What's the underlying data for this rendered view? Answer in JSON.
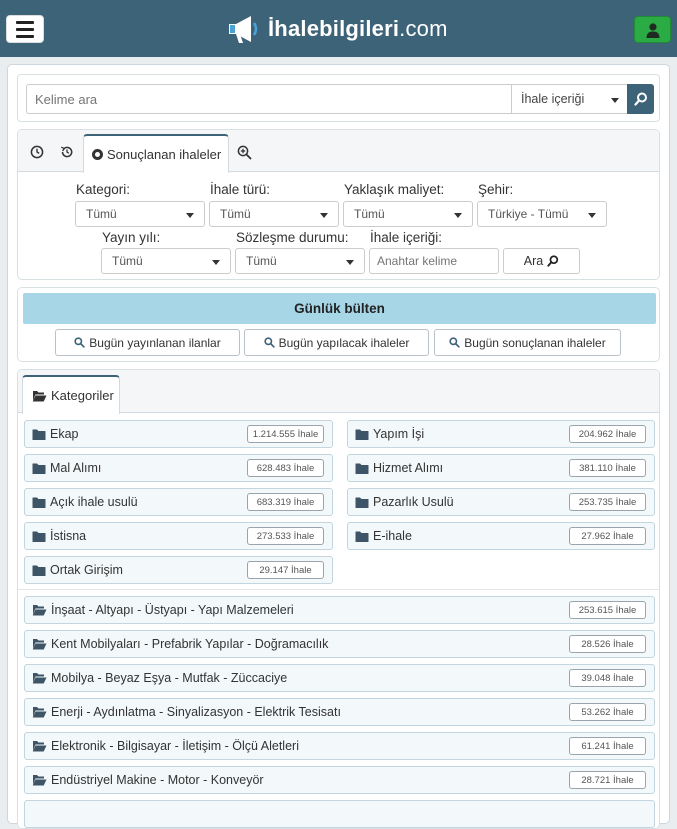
{
  "header": {
    "logo_bold": "İhalebilgileri",
    "logo_light": ".com",
    "colors": {
      "bar": "#3d6379",
      "user_button": "#2bab43"
    },
    "menu_icon": "hamburger-icon",
    "user_icon": "user-icon",
    "logo_icon": "megaphone-icon"
  },
  "search": {
    "placeholder": "Kelime ara",
    "scope_selected": "İhale içeriği"
  },
  "filters": {
    "active_tab": "Sonuçlanan ihaleler",
    "kategori": {
      "label": "Kategori:",
      "value": "Tümü"
    },
    "ihale_turu": {
      "label": "İhale türü:",
      "value": "Tümü"
    },
    "yaklasik_maliyet": {
      "label": "Yaklaşık maliyet:",
      "value": "Tümü"
    },
    "sehir": {
      "label": "Şehir:",
      "value": "Türkiye - Tümü"
    },
    "yayin_yili": {
      "label": "Yayın yılı:",
      "value": "Tümü"
    },
    "sozlesme_durumu": {
      "label": "Sözleşme durumu:",
      "value": "Tümü"
    },
    "ihale_icerigi": {
      "label": "İhale içeriği:",
      "placeholder": "Anahtar kelime"
    },
    "ara_label": "Ara"
  },
  "bulten": {
    "title": "Günlük bülten",
    "buttons": [
      "Bugün yayınlanan ilanlar",
      "Bugün yapılacak ihaleler",
      "Bugün sonuçlanan ihaleler"
    ]
  },
  "categories": {
    "tab_label": "Kategoriler",
    "types": [
      {
        "name": "Ekap",
        "count": "1.214.555 İhale"
      },
      {
        "name": "Yapım İşi",
        "count": "204.962 İhale"
      },
      {
        "name": "Mal Alımı",
        "count": "628.483 İhale"
      },
      {
        "name": "Hizmet Alımı",
        "count": "381.110 İhale"
      },
      {
        "name": "Açık ihale usulü",
        "count": "683.319 İhale"
      },
      {
        "name": "Pazarlık Usulü",
        "count": "253.735 İhale"
      },
      {
        "name": "İstisna",
        "count": "273.533 İhale"
      },
      {
        "name": "E-ihale",
        "count": "27.962 İhale"
      },
      {
        "name": "Ortak Girişim",
        "count": "29.147 İhale"
      }
    ],
    "sectors": [
      {
        "name": "İnşaat - Altyapı - Üstyapı - Yapı Malzemeleri",
        "count": "253.615 İhale"
      },
      {
        "name": "Kent Mobilyaları - Prefabrik Yapılar - Doğramacılık",
        "count": "28.526 İhale"
      },
      {
        "name": "Mobilya - Beyaz Eşya - Mutfak - Züccaciye",
        "count": "39.048 İhale"
      },
      {
        "name": "Enerji - Aydınlatma - Sinyalizasyon - Elektrik Tesisatı",
        "count": "53.262 İhale"
      },
      {
        "name": "Elektronik - Bilgisayar - İletişim - Ölçü Aletleri",
        "count": "61.241 İhale"
      },
      {
        "name": "Endüstriyel Makine - Motor - Konveyör",
        "count": "28.721 İhale"
      }
    ]
  }
}
